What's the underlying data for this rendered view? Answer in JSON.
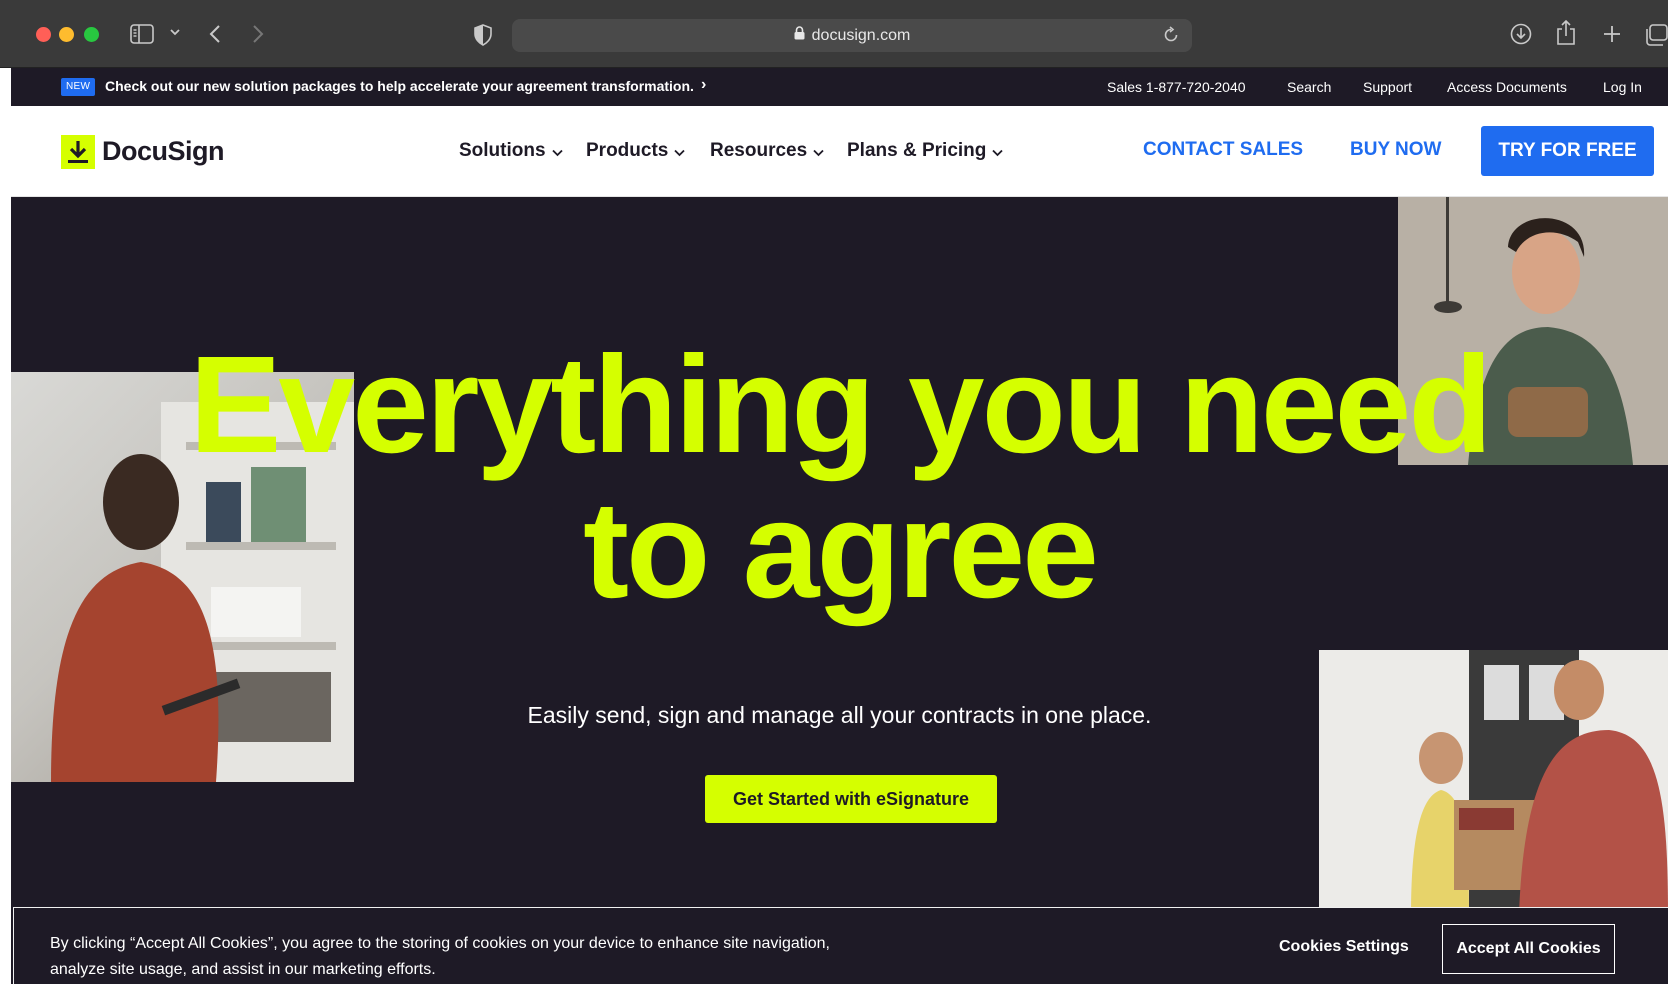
{
  "browser": {
    "url": "docusign.com"
  },
  "announcement": {
    "badge": "NEW",
    "text": "Check out our new solution packages to help accelerate your agreement transformation.",
    "chevron": "›"
  },
  "utility_nav": {
    "sales": "Sales 1-877-720-2040",
    "search": "Search",
    "support": "Support",
    "access_documents": "Access Documents",
    "log_in": "Log In"
  },
  "nav": {
    "logo_text": "DocuSign",
    "items": [
      {
        "label": "Solutions"
      },
      {
        "label": "Products"
      },
      {
        "label": "Resources"
      },
      {
        "label": "Plans & Pricing"
      }
    ],
    "contact_sales": "CONTACT SALES",
    "buy_now": "BUY NOW",
    "try_free": "TRY FOR FREE"
  },
  "hero": {
    "headline_line1": "Everything you need",
    "headline_line2": "to agree",
    "subheadline": "Easily send, sign and manage all your contracts in one place.",
    "cta": "Get Started with eSignature"
  },
  "cookie_banner": {
    "text": "By clicking “Accept All Cookies”, you agree to the storing of cookies on your device to enhance site navigation, analyze site usage, and assist in our marketing efforts.",
    "settings": "Cookies Settings",
    "accept": "Accept All Cookies"
  },
  "colors": {
    "brand_lime": "#d5ff00",
    "brand_blue": "#1f6cf0",
    "hero_bg": "#1e1a26"
  },
  "icons": {
    "logo": "download-arrow-icon",
    "address_lock": "lock-icon",
    "reload": "reload-icon",
    "downloads": "download-circle-icon",
    "share": "share-icon",
    "new_tab": "plus-icon",
    "tabs": "tabs-icon",
    "sidebar": "sidebar-icon",
    "back": "chevron-left-icon",
    "forward": "chevron-right-icon",
    "privacy": "shield-icon"
  }
}
